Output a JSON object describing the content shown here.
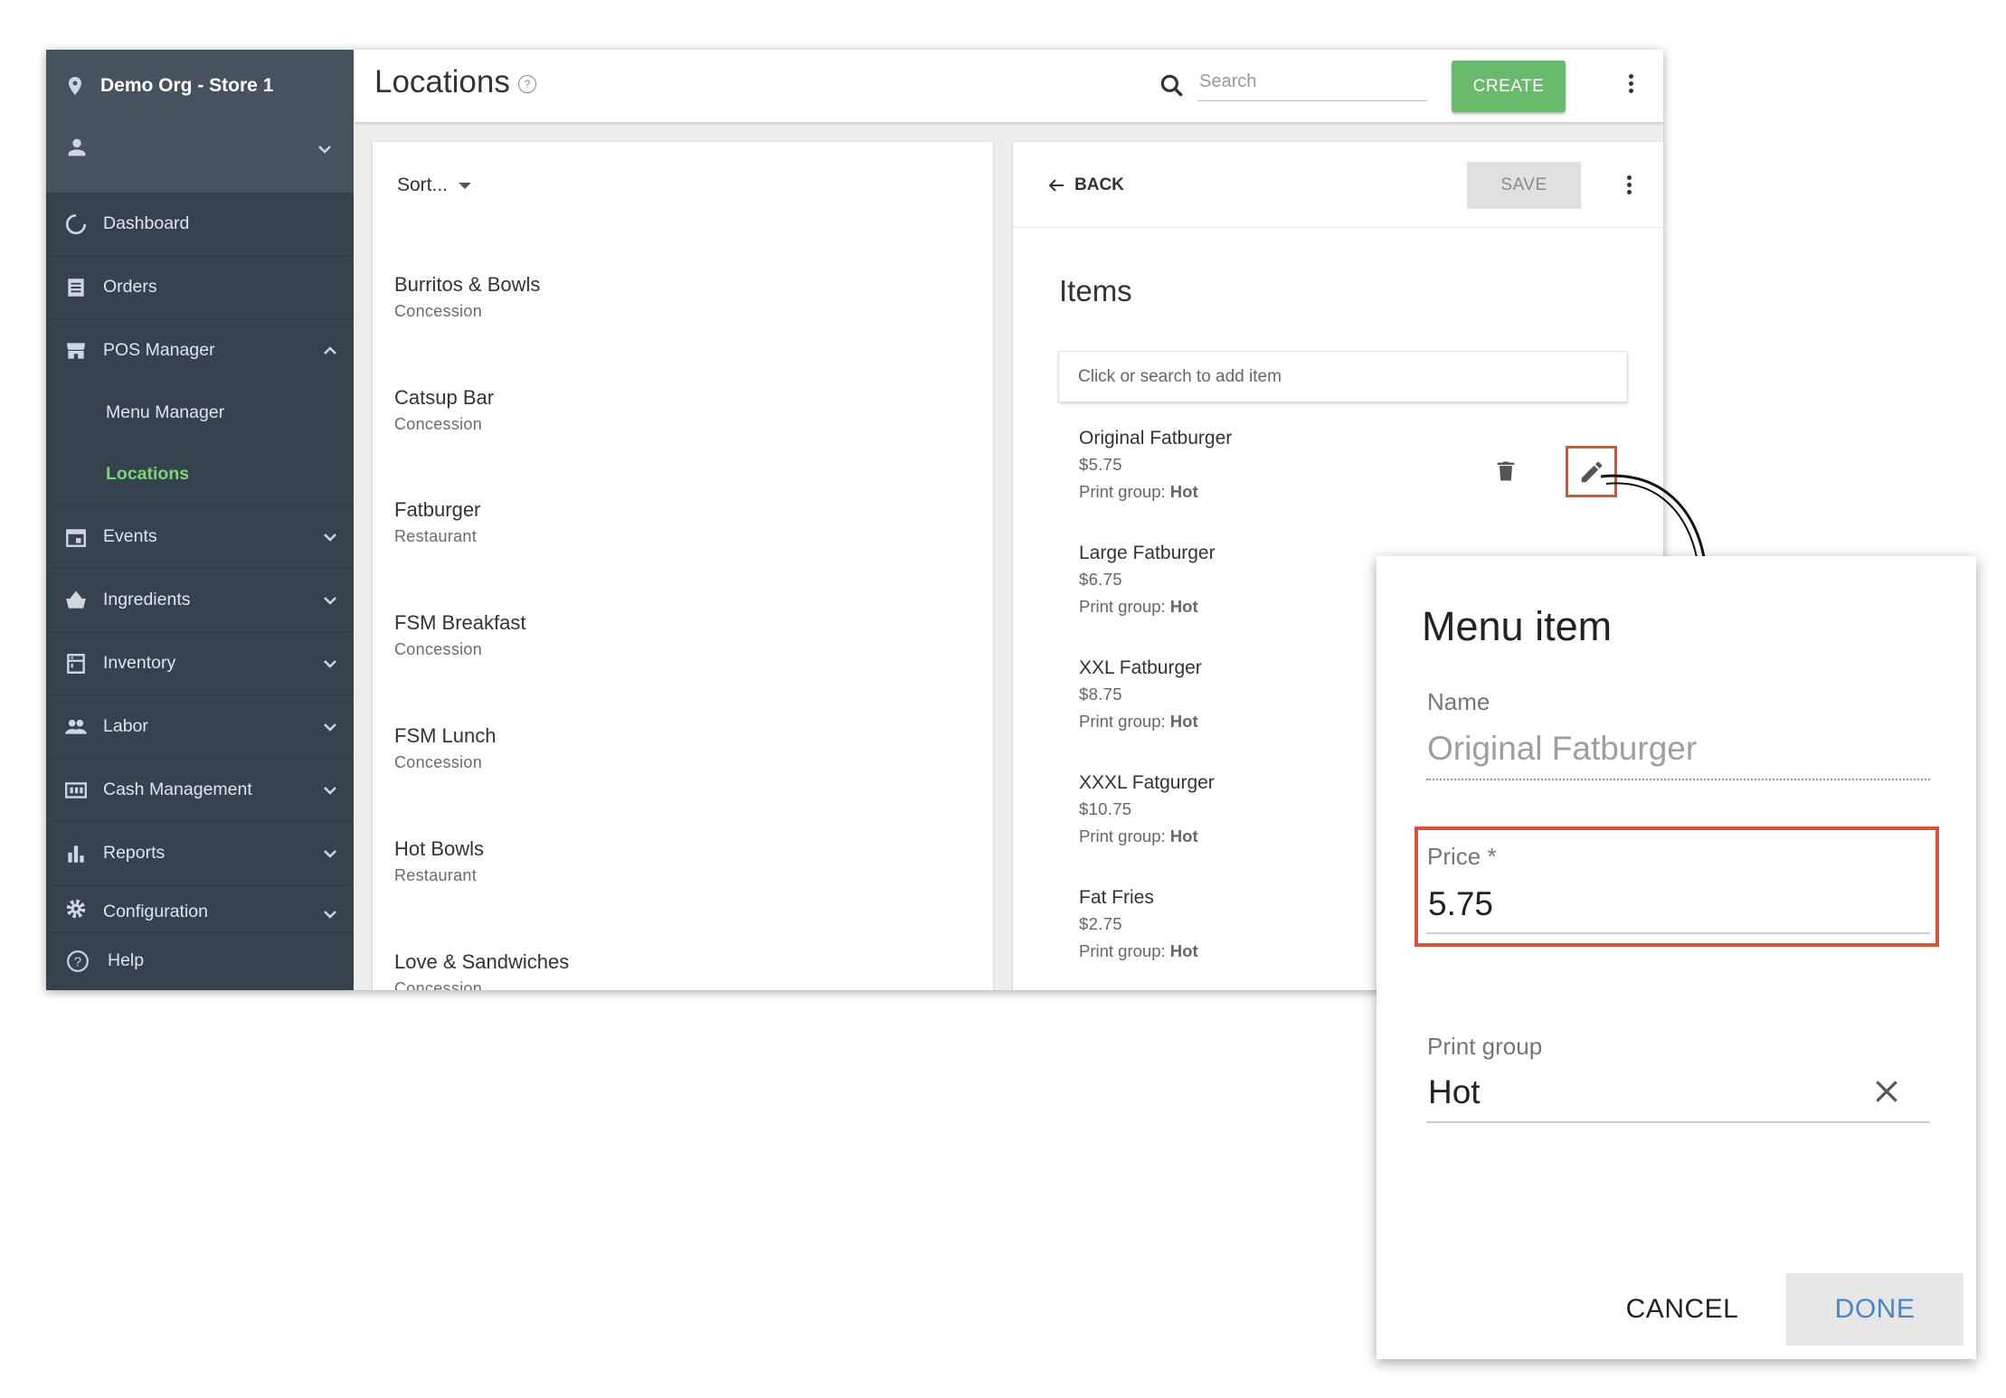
{
  "sidebar": {
    "org_name": "Demo Org - Store 1",
    "items": [
      {
        "label": "Dashboard",
        "icon": "dashboard-icon"
      },
      {
        "label": "Orders",
        "icon": "orders-icon"
      },
      {
        "label": "POS Manager",
        "icon": "store-icon",
        "expanded": true
      },
      {
        "label": "Menu Manager"
      },
      {
        "label": "Locations",
        "active": true
      },
      {
        "label": "Events",
        "icon": "calendar-icon"
      },
      {
        "label": "Ingredients",
        "icon": "basket-icon"
      },
      {
        "label": "Inventory",
        "icon": "inventory-icon"
      },
      {
        "label": "Labor",
        "icon": "people-icon"
      },
      {
        "label": "Cash Management",
        "icon": "cash-icon"
      },
      {
        "label": "Reports",
        "icon": "bar-chart-icon"
      },
      {
        "label": "Configuration",
        "icon": "gear-icon"
      },
      {
        "label": "Help",
        "icon": "help-icon"
      }
    ],
    "active_color": "#7ed47e"
  },
  "header": {
    "title": "Locations",
    "help_glyph": "?",
    "search_placeholder": "Search",
    "create_label": "CREATE",
    "create_color": "#6aba6e"
  },
  "list": {
    "sort_label": "Sort...",
    "locations": [
      {
        "name": "Burritos & Bowls",
        "type": "Concession"
      },
      {
        "name": "Catsup Bar",
        "type": "Concession"
      },
      {
        "name": "Fatburger",
        "type": "Restaurant"
      },
      {
        "name": "FSM Breakfast",
        "type": "Concession"
      },
      {
        "name": "FSM Lunch",
        "type": "Concession"
      },
      {
        "name": "Hot Bowls",
        "type": "Restaurant"
      },
      {
        "name": "Love & Sandwiches",
        "type": "Concession"
      }
    ]
  },
  "detail": {
    "back_label": "BACK",
    "save_label": "SAVE",
    "items_title": "Items",
    "add_item_placeholder": "Click or search to add item",
    "print_group_prefix": "Print group:",
    "items": [
      {
        "name": "Original Fatburger",
        "price": "$5.75",
        "print_group": "Hot"
      },
      {
        "name": "Large Fatburger",
        "price": "$6.75",
        "print_group": "Hot"
      },
      {
        "name": "XXL Fatburger",
        "price": "$8.75",
        "print_group": "Hot"
      },
      {
        "name": "XXXL Fatgurger",
        "price": "$10.75",
        "print_group": "Hot"
      },
      {
        "name": "Fat Fries",
        "price": "$2.75",
        "print_group": "Hot"
      }
    ]
  },
  "dialog": {
    "title": "Menu item",
    "name_label": "Name",
    "name_value": "Original Fatburger",
    "price_label": "Price *",
    "price_value": "5.75",
    "print_group_label": "Print group",
    "print_group_value": "Hot",
    "cancel_label": "CANCEL",
    "done_label": "DONE",
    "highlight_color": "#d4533a",
    "done_color": "#4a86c5"
  }
}
